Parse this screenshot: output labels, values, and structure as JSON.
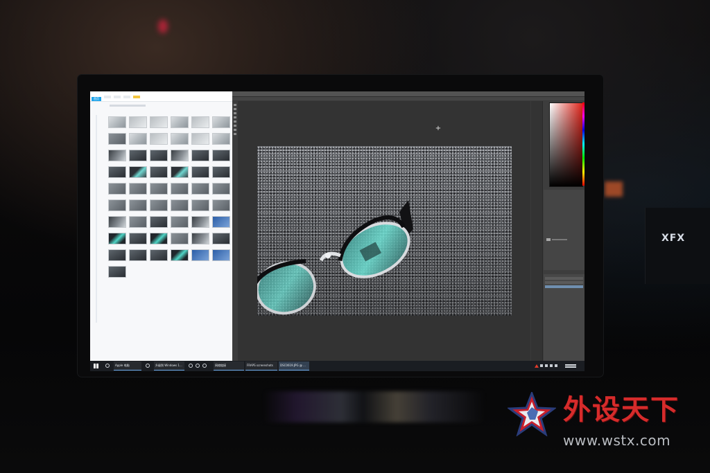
{
  "watermark": {
    "title": "外设天下",
    "url": "www.wstx.com"
  },
  "background": {
    "case_logo": "XFX"
  },
  "browser_app": {
    "badge": "首页",
    "thumbnail_count": 55
  },
  "photoshop": {
    "canvas_subject": "eyeglasses-on-fabric-photo",
    "picker_color": "#e0261c"
  },
  "taskbar": {
    "items": [
      {
        "label": "Apple 电脑"
      },
      {
        "label": "升级到 Windows 1..."
      },
      {
        "label": "网络链接"
      },
      {
        "label": "FRAPS screenshots"
      },
      {
        "label": "DSC0619.JPG @ ..."
      }
    ]
  },
  "colors": {
    "watermark_red": "#d62b2b",
    "accent_blue": "#1da3ea",
    "lens_teal": "#5fd6c9"
  }
}
